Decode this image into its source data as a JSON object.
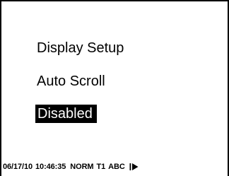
{
  "screen": {
    "title": "Display Setup",
    "item": "Auto Scroll",
    "value": "Disabled"
  },
  "status_bar": {
    "date": "06/17/10",
    "time": "10:46:35",
    "mode": "NORM",
    "trend": "T1",
    "input": "ABC",
    "icon": "play-right-icon"
  }
}
